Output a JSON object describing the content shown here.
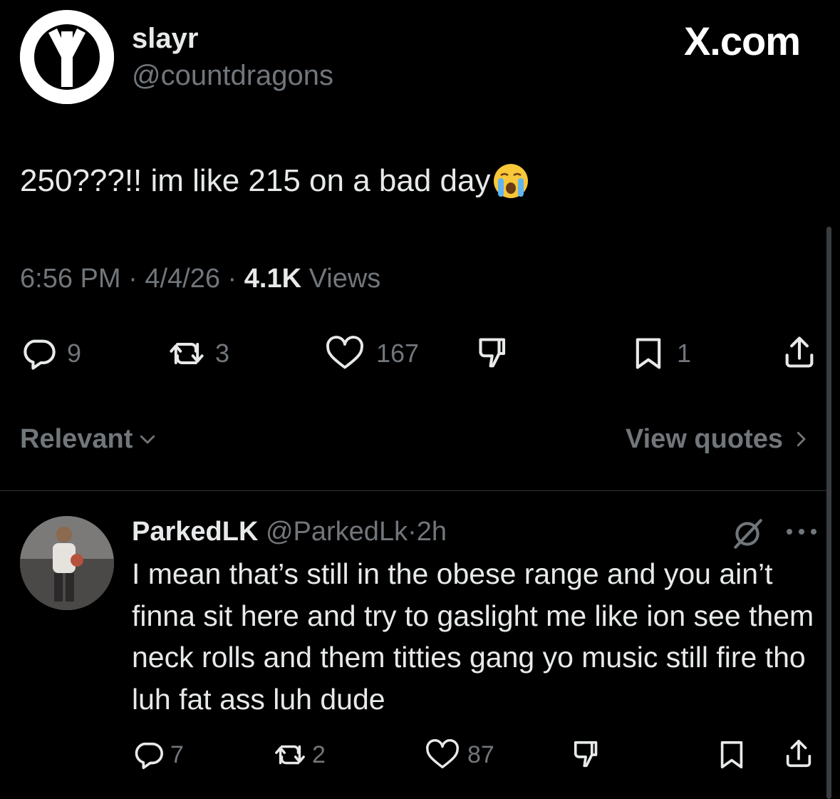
{
  "tweet": {
    "author": {
      "display_name": "slayr",
      "handle": "@countdragons"
    },
    "brand": "X.com",
    "text": "250???!! im like 215 on a bad day",
    "time": "6:56 PM",
    "date": "4/4/26",
    "views_count": "4.1K",
    "views_label": "Views",
    "actions": {
      "replies": "9",
      "reposts": "3",
      "likes": "167",
      "bookmarks": "1"
    }
  },
  "sort": {
    "label": "Relevant"
  },
  "quotes": {
    "label": "View quotes"
  },
  "reply": {
    "display_name": "ParkedLK",
    "handle": "@ParkedLk",
    "separator": "·",
    "time": "2h",
    "text": "I mean that’s still in the obese range and you ain’t finna sit here and try to gaslight me like ion see them neck rolls and them titties gang yo music still fire tho luh fat ass luh dude",
    "actions": {
      "replies": "7",
      "reposts": "2",
      "likes": "87"
    }
  },
  "colors": {
    "background": "#000000",
    "text_primary": "#e7e9ea",
    "text_secondary": "#71767b",
    "divider": "#2f3336"
  }
}
